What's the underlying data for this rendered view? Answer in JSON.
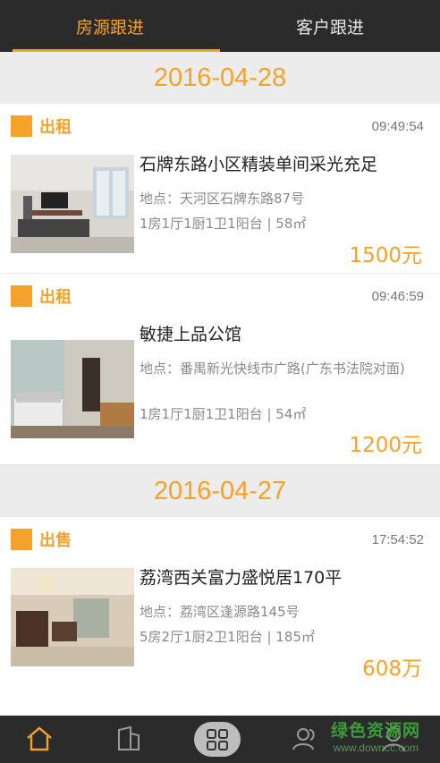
{
  "tabs": [
    {
      "label": "房源跟进",
      "active": true
    },
    {
      "label": "客户跟进",
      "active": false
    }
  ],
  "groups": [
    {
      "date": "2016-04-28",
      "listings": [
        {
          "type": "出租",
          "time": "09:49:54",
          "title": "石牌东路小区精装单间采光充足",
          "address": "地点：天河区石牌东路87号",
          "layout": "1房1厅1厨1卫1阳台 | 58㎡",
          "price": "1500元"
        },
        {
          "type": "出租",
          "time": "09:46:59",
          "title": "敏捷上品公馆",
          "address": "地点：番禺新光快线市广路(广东书法院对面)",
          "layout": "1房1厅1厨1卫1阳台 | 54㎡",
          "price": "1200元"
        }
      ]
    },
    {
      "date": "2016-04-27",
      "listings": [
        {
          "type": "出售",
          "time": "17:54:52",
          "title": "荔湾西关富力盛悦居170平",
          "address": "地点：荔湾区逢源路145号",
          "layout": "5房2厅1厨2卫1阳台 | 185㎡",
          "price": "608万"
        }
      ]
    }
  ],
  "bottom_nav": [
    {
      "icon": "home-icon",
      "active": true
    },
    {
      "icon": "building-icon",
      "active": false
    },
    {
      "icon": "grid-icon",
      "active": false
    },
    {
      "icon": "users-icon",
      "active": false
    },
    {
      "icon": "person-icon",
      "active": false
    }
  ],
  "watermark": {
    "line1": "绿色资源网",
    "line2": "www.downcc.com"
  },
  "colors": {
    "accent": "#f5a22a",
    "bar": "#2b2b2b",
    "date_bg": "#ececec"
  }
}
